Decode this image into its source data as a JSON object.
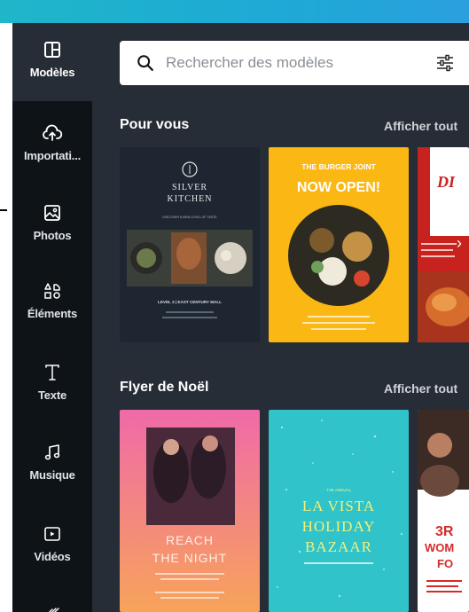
{
  "sidebar": {
    "items": [
      {
        "label": "Modèles",
        "icon": "templates-icon",
        "active": true
      },
      {
        "label": "Importati...",
        "icon": "upload-cloud-icon",
        "active": false
      },
      {
        "label": "Photos",
        "icon": "photo-icon",
        "active": false
      },
      {
        "label": "Éléments",
        "icon": "shapes-icon",
        "active": false
      },
      {
        "label": "Texte",
        "icon": "text-icon",
        "active": false
      },
      {
        "label": "Musique",
        "icon": "music-icon",
        "active": false
      },
      {
        "label": "Vidéos",
        "icon": "video-icon",
        "active": false
      }
    ]
  },
  "search": {
    "placeholder": "Rechercher des modèles"
  },
  "sections": [
    {
      "title": "Pour vous",
      "link": "Afficher tout",
      "cards": [
        {
          "brand": "SILVER KITCHEN",
          "tagline": "DISCOVER A NEW LEVEL OF TASTE",
          "footer": "LEVEL 3 | EAST CENTURY MALL"
        },
        {
          "headline1": "THE BURGER JOINT",
          "headline2": "NOW OPEN!"
        },
        {
          "headline": "DI"
        }
      ]
    },
    {
      "title": "Flyer de Noël",
      "link": "Afficher tout",
      "cards": [
        {
          "headline1": "REACH",
          "headline2": "THE NIGHT"
        },
        {
          "kicker": "THE ANNUAL",
          "line1": "LA VISTA",
          "line2": "HOLIDAY",
          "line3": "BAZAAR"
        },
        {
          "line1": "3R",
          "line2": "WOM",
          "line3": "FO"
        }
      ]
    }
  ],
  "colors": {
    "topbar": "#1fb6c9",
    "sidebar": "#0e1318",
    "panel": "#272d36"
  }
}
